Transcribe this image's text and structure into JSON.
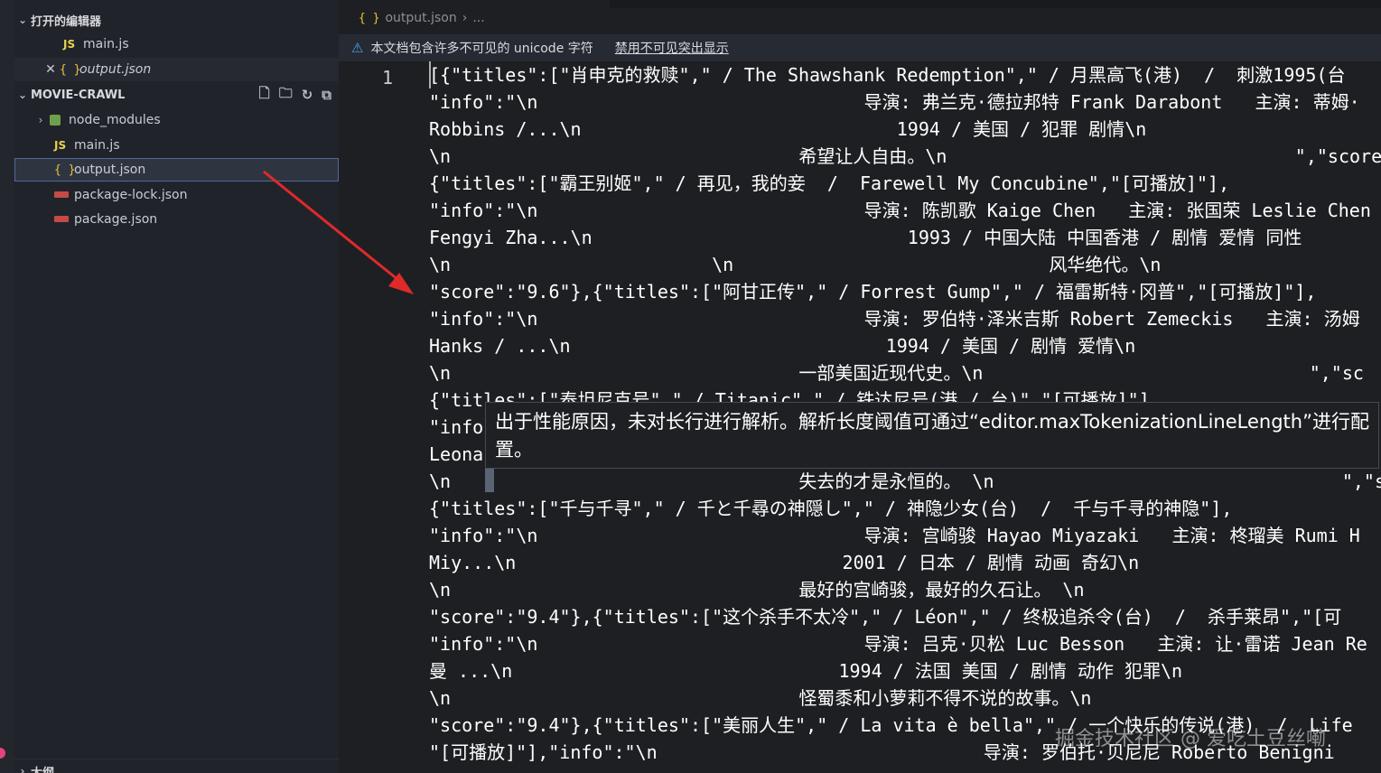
{
  "sidebar": {
    "open_editors_header": "打开的编辑器",
    "open_editors": [
      {
        "label": "main.js",
        "icon": "js"
      },
      {
        "label": "output.json",
        "icon": "json"
      }
    ],
    "project_header": "MOVIE-CRAWL",
    "tree": [
      {
        "label": "node_modules",
        "icon": "folder"
      },
      {
        "label": "main.js",
        "icon": "js"
      },
      {
        "label": "output.json",
        "icon": "json"
      },
      {
        "label": "package-lock.json",
        "icon": "npm"
      },
      {
        "label": "package.json",
        "icon": "npm"
      }
    ],
    "outline_header": "大纲",
    "icons": {
      "js_glyph": "JS",
      "json_glyph": "{ }",
      "close_glyph": "✕",
      "chevron_down": "⌄",
      "chevron_right": "›"
    }
  },
  "editor": {
    "breadcrumb": {
      "icon": "{ }",
      "file": "output.json",
      "sep": "›",
      "tail": "..."
    },
    "banner": {
      "text": "本文档包含许多不可见的 unicode 字符",
      "link": "禁用不可见突出显示"
    },
    "line_number": "1",
    "lines": [
      "[{\"titles\":[\"肖申克的救赎\",\" / The Shawshank Redemption\",\" / 月黑高飞(港)  /  刺激1995(台",
      "\"info\":\"\\n                              导演: 弗兰克·德拉邦特 Frank Darabont   主演: 蒂姆·",
      "Robbins /...\\n                             1994 / 美国 / 犯罪 剧情\\n",
      "\\n                                希望让人自由。\\n                                \",\"score\"",
      "{\"titles\":[\"霸王别姬\",\" / 再见，我的妾  /  Farewell My Concubine\",\"[可播放]\"],",
      "\"info\":\"\\n                              导演: 陈凯歌 Kaige Chen   主演: 张国荣 Leslie Chen",
      "Fengyi Zha...\\n                             1993 / 中国大陆 中国香港 / 剧情 爱情 同性",
      "\\n                        \\n                             风华绝代。\\n",
      "\"score\":\"9.6\"},{\"titles\":[\"阿甘正传\",\" / Forrest Gump\",\" / 福雷斯特·冈普\",\"[可播放]\"],",
      "\"info\":\"\\n                              导演: 罗伯特·泽米吉斯 Robert Zemeckis   主演: 汤姆",
      "Hanks / ...\\n                             1994 / 美国 / 剧情 爱情\\n",
      "\\n                                一部美国近现代史。\\n                              \",\"sc",
      "{\"titles\":[\"泰坦尼克号\",\" / Titanic\",\" / 铁达尼号(港 / 台)\",\"[可播放]\"],",
      "\"info",
      "Leona",
      "\\n                                失去的才是永恒的。 \\n                                \",\"s",
      "{\"titles\":[\"千与千寻\",\" / 千と千尋の神隠し\",\" / 神隐少女(台)  /  千与千寻的神隐\"],",
      "\"info\":\"\\n                              导演: 宫崎骏 Hayao Miyazaki   主演: 柊瑠美 Rumi H",
      "Miy...\\n                              2001 / 日本 / 剧情 动画 奇幻\\n",
      "\\n                                最好的宫崎骏，最好的久石让。 \\n",
      "\"score\":\"9.4\"},{\"titles\":[\"这个杀手不太冷\",\" / Léon\",\" / 终极追杀令(台)  /  杀手莱昂\",\"[可",
      "\"info\":\"\\n                              导演: 吕克·贝松 Luc Besson   主演: 让·雷诺 Jean Re",
      "曼 ...\\n                              1994 / 法国 美国 / 剧情 动作 犯罪\\n",
      "\\n                                怪蜀黍和小萝莉不得不说的故事。\\n",
      "\"score\":\"9.4\"},{\"titles\":[\"美丽人生\",\" / La vita è bella\",\" / 一个快乐的传说(港)  /  Life",
      "\"[可播放]\"],\"info\":\"\\n                              导演: 罗伯托·贝尼尼 Roberto Benigni"
    ],
    "tooltip": "出于性能原因，未对长行进行解析。解析长度阈值可通过“editor.maxTokenizationLineLength”进行配置。"
  },
  "watermark": "掘金技术社区 @ 爱吃土豆丝嘞"
}
